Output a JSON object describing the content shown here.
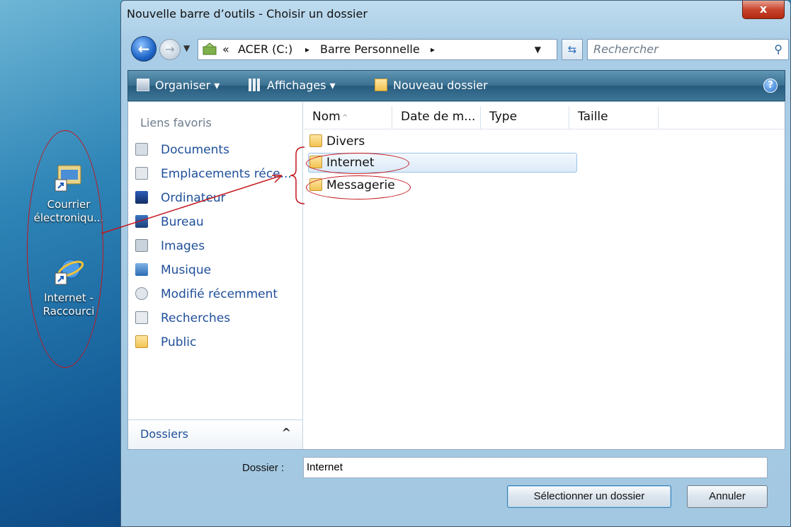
{
  "desktop": {
    "icons": [
      {
        "label": "Courrier électroniqu..."
      },
      {
        "label": "Internet - Raccourci"
      }
    ]
  },
  "window": {
    "title": "Nouvelle barre d’outils - Choisir un dossier",
    "close_label": "x"
  },
  "address_bar": {
    "chevron": "«",
    "segments": [
      "ACER (C:)",
      "Barre Personnelle"
    ],
    "separator": "▸"
  },
  "search": {
    "placeholder": "Rechercher"
  },
  "toolbar": {
    "organiser": "Organiser",
    "affichages": "Affichages",
    "nouveau_dossier": "Nouveau dossier",
    "help": "?"
  },
  "nav_pane": {
    "favorites_header": "Liens favoris",
    "items": [
      {
        "label": "Documents",
        "icon": "documents-icon"
      },
      {
        "label": "Emplacements réce...",
        "icon": "recent-places-icon"
      },
      {
        "label": "Ordinateur",
        "icon": "computer-icon"
      },
      {
        "label": "Bureau",
        "icon": "desktop-icon"
      },
      {
        "label": "Images",
        "icon": "pictures-icon"
      },
      {
        "label": "Musique",
        "icon": "music-icon"
      },
      {
        "label": "Modifié récemment",
        "icon": "recently-changed-icon"
      },
      {
        "label": "Recherches",
        "icon": "searches-icon"
      },
      {
        "label": "Public",
        "icon": "folder-icon"
      }
    ],
    "folders_label": "Dossiers",
    "folders_chevron": "^"
  },
  "file_list": {
    "columns": [
      "Nom",
      "Date de m...",
      "Type",
      "Taille"
    ],
    "rows": [
      {
        "name": "Divers"
      },
      {
        "name": "Internet"
      },
      {
        "name": "Messagerie"
      }
    ]
  },
  "footer": {
    "folder_label": "Dossier :",
    "folder_value": "Internet",
    "select_button": "Sélectionner un dossier",
    "cancel_button": "Annuler"
  },
  "colors": {
    "annotation": "#c4161c",
    "link_text": "#1f4f9a"
  }
}
